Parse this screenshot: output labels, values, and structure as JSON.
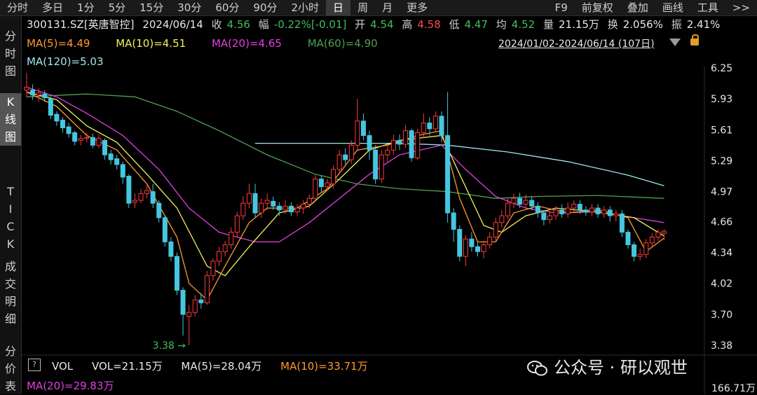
{
  "toolbar": {
    "items": [
      "分时",
      "多日",
      "1分",
      "5分",
      "15分",
      "30分",
      "60分",
      "90分",
      "2小时",
      "日",
      "周",
      "月",
      "更多"
    ],
    "active_index": 9,
    "right_items": [
      "F9",
      "前复权",
      "叠加",
      "画线",
      "工具",
      ">>"
    ]
  },
  "left_tabs": [
    {
      "label": "分时图",
      "active": false
    },
    {
      "label": "K线图",
      "active": true
    },
    {
      "label": "TICK",
      "active": false
    },
    {
      "label": "成交明细",
      "active": false
    },
    {
      "label": "分价表",
      "active": false
    }
  ],
  "info": {
    "code": "300131.SZ[英唐智控]",
    "date": "2024/06/14",
    "close_label": "收",
    "close": "4.56",
    "change_label": "幅",
    "change": "-0.22%[-0.01]",
    "open_label": "开",
    "open": "4.54",
    "high_label": "高",
    "high": "4.58",
    "low_label": "低",
    "low": "4.47",
    "avg_label": "均",
    "avg": "4.52",
    "vol_label": "量",
    "vol": "21.15万",
    "turn_label": "换",
    "turn": "2.056%",
    "amp_label": "振",
    "amp": "2.41%"
  },
  "ma": {
    "ma5": "MA(5)=4.49",
    "ma10": "MA(10)=4.51",
    "ma20": "MA(20)=4.65",
    "ma60": "MA(60)=4.90",
    "ma120": "MA(120)=5.03"
  },
  "range_text": "2024/01/02-2024/06/14 (107日)",
  "low_marker": "3.38",
  "volume": {
    "vol_title": "VOL",
    "vol": "VOL=21.15万",
    "ma5": "MA(5)=28.04万",
    "ma10": "MA(10)=33.71万",
    "ma20": "MA(20)=29.83万",
    "max": "166.71万"
  },
  "watermark": "公众号 · 研以观世",
  "chart_data": {
    "type": "candlestick",
    "title": "300131.SZ[英唐智控]",
    "y_ticks": [
      6.25,
      5.93,
      5.61,
      5.29,
      4.97,
      4.66,
      4.34,
      4.02,
      3.7,
      3.38
    ],
    "ylim": [
      3.33,
      6.3
    ],
    "colors": {
      "up": "#ff3b3b",
      "down": "#46c6e0",
      "ma5": "#ff9a2e",
      "ma10": "#f2f25a",
      "ma20": "#e040e0",
      "ma60": "#4fa04f",
      "ma120": "#9ee8f0"
    },
    "candles": [
      [
        6.02,
        6.05,
        5.95,
        6.2
      ],
      [
        6.02,
        5.97,
        5.92,
        6.08
      ],
      [
        5.97,
        5.99,
        5.9,
        6.04
      ],
      [
        5.98,
        5.94,
        5.9,
        6.02
      ],
      [
        5.93,
        5.76,
        5.72,
        5.95
      ],
      [
        5.77,
        5.7,
        5.65,
        5.8
      ],
      [
        5.71,
        5.63,
        5.58,
        5.74
      ],
      [
        5.64,
        5.57,
        5.53,
        5.68
      ],
      [
        5.58,
        5.49,
        5.45,
        5.6
      ],
      [
        5.5,
        5.52,
        5.45,
        5.56
      ],
      [
        5.52,
        5.53,
        5.48,
        5.58
      ],
      [
        5.53,
        5.45,
        5.42,
        5.57
      ],
      [
        5.45,
        5.52,
        5.42,
        5.56
      ],
      [
        5.5,
        5.35,
        5.3,
        5.52
      ],
      [
        5.36,
        5.3,
        5.25,
        5.4
      ],
      [
        5.31,
        5.25,
        5.2,
        5.35
      ],
      [
        5.25,
        5.12,
        5.05,
        5.28
      ],
      [
        5.13,
        4.85,
        4.8,
        5.15
      ],
      [
        4.86,
        4.88,
        4.8,
        4.95
      ],
      [
        4.88,
        4.95,
        4.85,
        5.0
      ],
      [
        4.95,
        4.98,
        4.9,
        5.04
      ],
      [
        4.97,
        4.85,
        4.8,
        5.05
      ],
      [
        4.85,
        4.7,
        4.65,
        4.88
      ],
      [
        4.7,
        4.45,
        4.4,
        4.72
      ],
      [
        4.45,
        4.3,
        4.25,
        4.5
      ],
      [
        4.3,
        3.95,
        3.9,
        4.34
      ],
      [
        3.95,
        3.7,
        3.48,
        3.98
      ],
      [
        3.68,
        3.72,
        3.38,
        3.8
      ],
      [
        3.72,
        3.85,
        3.68,
        3.9
      ],
      [
        3.85,
        3.82,
        3.76,
        3.92
      ],
      [
        3.82,
        4.1,
        3.8,
        4.15
      ],
      [
        4.1,
        4.25,
        4.05,
        4.28
      ],
      [
        4.25,
        4.35,
        4.2,
        4.4
      ],
      [
        4.35,
        4.42,
        4.3,
        4.46
      ],
      [
        4.42,
        4.55,
        4.38,
        4.6
      ],
      [
        4.55,
        4.72,
        4.5,
        4.76
      ],
      [
        4.72,
        4.85,
        4.68,
        4.92
      ],
      [
        4.85,
        4.95,
        4.8,
        5.05
      ],
      [
        4.95,
        4.75,
        4.7,
        5.05
      ],
      [
        4.75,
        4.85,
        4.7,
        4.9
      ],
      [
        4.85,
        4.88,
        4.78,
        4.95
      ],
      [
        4.87,
        4.82,
        4.78,
        4.92
      ],
      [
        4.82,
        4.78,
        4.72,
        4.86
      ],
      [
        4.78,
        4.82,
        4.74,
        4.88
      ],
      [
        4.82,
        4.76,
        4.72,
        4.86
      ],
      [
        4.76,
        4.8,
        4.72,
        4.84
      ],
      [
        4.8,
        4.84,
        4.74,
        4.88
      ],
      [
        4.84,
        4.9,
        4.8,
        4.94
      ],
      [
        4.9,
        5.1,
        4.88,
        5.14
      ],
      [
        5.1,
        5.02,
        4.96,
        5.14
      ],
      [
        5.02,
        5.06,
        4.98,
        5.1
      ],
      [
        5.05,
        5.2,
        5.0,
        5.24
      ],
      [
        5.2,
        5.35,
        5.15,
        5.4
      ],
      [
        5.35,
        5.3,
        5.25,
        5.42
      ],
      [
        5.3,
        5.45,
        5.26,
        5.5
      ],
      [
        5.45,
        5.7,
        5.4,
        5.93
      ],
      [
        5.7,
        5.55,
        5.5,
        5.78
      ],
      [
        5.55,
        5.4,
        5.3,
        5.6
      ],
      [
        5.4,
        5.1,
        5.05,
        5.45
      ],
      [
        5.1,
        5.35,
        5.06,
        5.4
      ],
      [
        5.35,
        5.4,
        5.28,
        5.46
      ],
      [
        5.4,
        5.5,
        5.35,
        5.56
      ],
      [
        5.5,
        5.46,
        5.4,
        5.56
      ],
      [
        5.46,
        5.6,
        5.42,
        5.66
      ],
      [
        5.6,
        5.32,
        5.28,
        5.62
      ],
      [
        5.32,
        5.58,
        5.3,
        5.62
      ],
      [
        5.58,
        5.68,
        5.52,
        5.78
      ],
      [
        5.68,
        5.62,
        5.55,
        5.74
      ],
      [
        5.62,
        5.75,
        5.58,
        5.8
      ],
      [
        5.75,
        5.55,
        5.48,
        5.8
      ],
      [
        5.55,
        4.75,
        4.65,
        6.0
      ],
      [
        4.75,
        4.58,
        4.45,
        4.8
      ],
      [
        4.58,
        4.3,
        4.25,
        4.62
      ],
      [
        4.3,
        4.48,
        4.2,
        4.52
      ],
      [
        4.48,
        4.4,
        4.35,
        4.55
      ],
      [
        4.4,
        4.35,
        4.3,
        4.45
      ],
      [
        4.35,
        4.42,
        4.28,
        4.46
      ],
      [
        4.42,
        4.5,
        4.38,
        4.55
      ],
      [
        4.5,
        4.65,
        4.45,
        4.7
      ],
      [
        4.65,
        4.72,
        4.6,
        4.78
      ],
      [
        4.72,
        4.85,
        4.68,
        4.9
      ],
      [
        4.85,
        4.9,
        4.8,
        4.95
      ],
      [
        4.9,
        4.84,
        4.8,
        4.96
      ],
      [
        4.84,
        4.88,
        4.8,
        4.94
      ],
      [
        4.88,
        4.82,
        4.78,
        4.92
      ],
      [
        4.82,
        4.75,
        4.7,
        4.86
      ],
      [
        4.75,
        4.68,
        4.62,
        4.78
      ],
      [
        4.68,
        4.72,
        4.64,
        4.76
      ],
      [
        4.72,
        4.78,
        4.68,
        4.82
      ],
      [
        4.78,
        4.74,
        4.7,
        4.84
      ],
      [
        4.74,
        4.8,
        4.7,
        4.86
      ],
      [
        4.8,
        4.84,
        4.76,
        4.88
      ],
      [
        4.84,
        4.78,
        4.74,
        4.88
      ],
      [
        4.78,
        4.76,
        4.72,
        4.82
      ],
      [
        4.76,
        4.8,
        4.72,
        4.84
      ],
      [
        4.8,
        4.74,
        4.7,
        4.84
      ],
      [
        4.74,
        4.78,
        4.7,
        4.82
      ],
      [
        4.78,
        4.72,
        4.66,
        4.82
      ],
      [
        4.72,
        4.74,
        4.66,
        4.78
      ],
      [
        4.74,
        4.55,
        4.5,
        4.78
      ],
      [
        4.55,
        4.42,
        4.38,
        4.58
      ],
      [
        4.42,
        4.3,
        4.25,
        4.45
      ],
      [
        4.3,
        4.32,
        4.26,
        4.38
      ],
      [
        4.32,
        4.44,
        4.28,
        4.48
      ],
      [
        4.44,
        4.5,
        4.4,
        4.54
      ],
      [
        4.5,
        4.55,
        4.46,
        4.58
      ],
      [
        4.54,
        4.56,
        4.47,
        4.58
      ]
    ],
    "ma_lines": {
      "ma5": [
        [
          0,
          6.0
        ],
        [
          5,
          5.85
        ],
        [
          10,
          5.55
        ],
        [
          15,
          5.4
        ],
        [
          20,
          5.05
        ],
        [
          25,
          4.5
        ],
        [
          27,
          4.02
        ],
        [
          30,
          3.85
        ],
        [
          33,
          4.2
        ],
        [
          37,
          4.65
        ],
        [
          40,
          4.8
        ],
        [
          45,
          4.8
        ],
        [
          50,
          5.0
        ],
        [
          55,
          5.4
        ],
        [
          60,
          5.45
        ],
        [
          65,
          5.55
        ],
        [
          69,
          5.6
        ],
        [
          72,
          4.9
        ],
        [
          75,
          4.45
        ],
        [
          78,
          4.45
        ],
        [
          81,
          4.75
        ],
        [
          85,
          4.82
        ],
        [
          90,
          4.75
        ],
        [
          95,
          4.78
        ],
        [
          100,
          4.7
        ],
        [
          103,
          4.35
        ],
        [
          106,
          4.49
        ]
      ],
      "ma10": [
        [
          0,
          6.0
        ],
        [
          5,
          5.92
        ],
        [
          10,
          5.65
        ],
        [
          15,
          5.48
        ],
        [
          20,
          5.15
        ],
        [
          25,
          4.8
        ],
        [
          30,
          4.2
        ],
        [
          33,
          4.1
        ],
        [
          37,
          4.4
        ],
        [
          42,
          4.75
        ],
        [
          47,
          4.82
        ],
        [
          52,
          5.1
        ],
        [
          57,
          5.4
        ],
        [
          62,
          5.5
        ],
        [
          69,
          5.55
        ],
        [
          72,
          5.15
        ],
        [
          76,
          4.62
        ],
        [
          79,
          4.55
        ],
        [
          83,
          4.72
        ],
        [
          88,
          4.8
        ],
        [
          95,
          4.76
        ],
        [
          101,
          4.7
        ],
        [
          106,
          4.51
        ]
      ],
      "ma20": [
        [
          0,
          6.05
        ],
        [
          5,
          5.95
        ],
        [
          10,
          5.78
        ],
        [
          16,
          5.55
        ],
        [
          22,
          5.2
        ],
        [
          27,
          4.8
        ],
        [
          32,
          4.55
        ],
        [
          38,
          4.45
        ],
        [
          42,
          4.45
        ],
        [
          47,
          4.65
        ],
        [
          52,
          4.9
        ],
        [
          57,
          5.15
        ],
        [
          62,
          5.35
        ],
        [
          69,
          5.45
        ],
        [
          73,
          5.2
        ],
        [
          78,
          4.92
        ],
        [
          83,
          4.8
        ],
        [
          88,
          4.75
        ],
        [
          95,
          4.76
        ],
        [
          101,
          4.7
        ],
        [
          106,
          4.65
        ]
      ],
      "ma60": [
        [
          0,
          5.95
        ],
        [
          10,
          5.98
        ],
        [
          18,
          5.95
        ],
        [
          25,
          5.8
        ],
        [
          32,
          5.6
        ],
        [
          40,
          5.35
        ],
        [
          48,
          5.15
        ],
        [
          55,
          5.05
        ],
        [
          62,
          5.0
        ],
        [
          70,
          4.97
        ],
        [
          78,
          4.9
        ],
        [
          85,
          4.92
        ],
        [
          95,
          4.93
        ],
        [
          106,
          4.9
        ]
      ],
      "ma120": [
        [
          38,
          5.47
        ],
        [
          50,
          5.47
        ],
        [
          62,
          5.47
        ],
        [
          70,
          5.45
        ],
        [
          80,
          5.38
        ],
        [
          90,
          5.28
        ],
        [
          100,
          5.14
        ],
        [
          106,
          5.03
        ]
      ]
    }
  }
}
